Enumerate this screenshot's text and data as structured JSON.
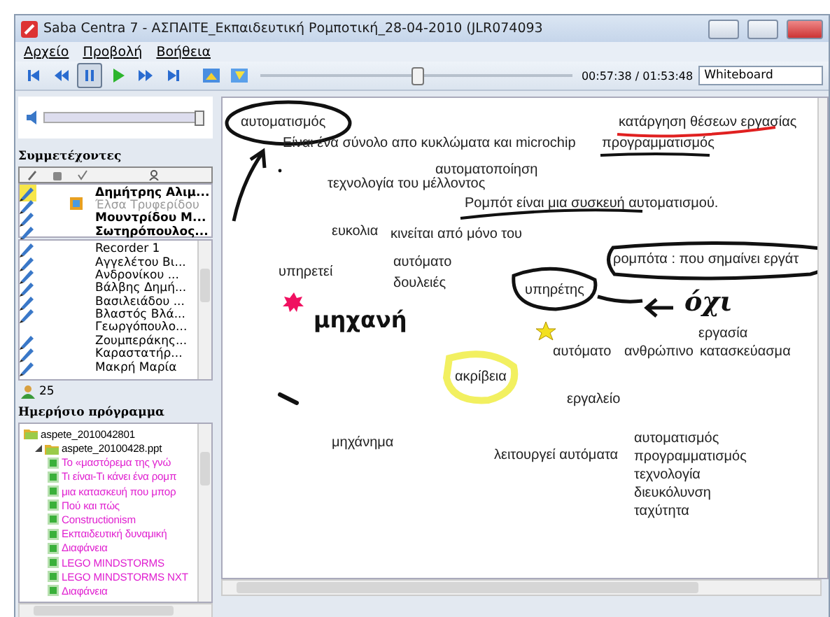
{
  "window": {
    "title": "Saba Centra 7 - ΑΣΠΑΙΤΕ_Εκπαιδευτική Ρομποτική_28-04-2010 (JLR074093"
  },
  "menu": [
    "Αρχείο",
    "Προβολή",
    "Βοήθεια"
  ],
  "toolbar": {
    "buttons": [
      {
        "kind": "first",
        "selected": false
      },
      {
        "kind": "rewind",
        "selected": false
      },
      {
        "kind": "pause",
        "selected": true
      },
      {
        "kind": "play",
        "selected": false
      },
      {
        "kind": "forward",
        "selected": false
      },
      {
        "kind": "last",
        "selected": false
      },
      {
        "kind": "image1",
        "selected": false
      },
      {
        "kind": "image2",
        "selected": false
      }
    ],
    "position": {
      "level": 0.5
    },
    "time": "00:57:38 / 01:53:48",
    "view": "Whiteboard"
  },
  "sidebar": {
    "volume": {
      "level": 1
    },
    "participants_title": "Συμμετέχοντες",
    "presenters": [
      {
        "name": "Δημήτρης Αλιμ...",
        "speaking": true,
        "present": true,
        "sharing": false
      },
      {
        "name": "Έλσα Τρυφερίδου",
        "speaking": false,
        "present": false,
        "sharing": true
      },
      {
        "name": "Μουντρίδου Μ...",
        "speaking": false,
        "present": true,
        "sharing": false
      },
      {
        "name": "Σωτηρόπουλος...",
        "speaking": false,
        "present": true,
        "sharing": false
      }
    ],
    "attendees": [
      {
        "name": "Recorder 1",
        "pen": true
      },
      {
        "name": "Αγγελέτου Βι...",
        "pen": true
      },
      {
        "name": "Ανδρονίκου ...",
        "pen": true
      },
      {
        "name": "Βάλβης Δημή...",
        "pen": true
      },
      {
        "name": "Βασιλειάδου ...",
        "pen": true
      },
      {
        "name": "Βλαστός Βλά...",
        "pen": true
      },
      {
        "name": "Γεωργόπουλο...",
        "pen": false
      },
      {
        "name": "Ζουμπεράκης...",
        "pen": true
      },
      {
        "name": "Καραστατήρ...",
        "pen": true
      },
      {
        "name": "Μακρή Μαρία",
        "pen": true
      }
    ],
    "count": "25",
    "agenda_title": "Ημερήσιο πρόγραμμα",
    "agenda": [
      {
        "label": "aspete_2010042801",
        "children": [
          {
            "label": "aspete_20100428.ppt",
            "expanded": true,
            "children": [
              {
                "label": "Το «μαστόρεμα της γνώ"
              },
              {
                "label": "Τι είναι-Τι κάνει ένα ρομπ"
              },
              {
                "label": "μια κατασκευή που μπορ"
              },
              {
                "label": "Πού και πώς"
              },
              {
                "label": "Constructionism"
              },
              {
                "label": "Εκπαιδευτική δυναμική"
              },
              {
                "label": "Διαφάνεια"
              },
              {
                "label": "LEGO MINDSTORMS"
              },
              {
                "label": "LEGO MINDSTORMS NXT"
              },
              {
                "label": "Διαφάνεια"
              }
            ]
          }
        ]
      }
    ]
  },
  "whiteboard": {
    "items": [
      {
        "kind": "text",
        "text": "αυτοματισμός"
      },
      {
        "kind": "text",
        "text": "Είναι ένα σύνολο απο κυκλώματα και microchip"
      },
      {
        "kind": "text",
        "text": "κατάργηση θέσεων εργασίας"
      },
      {
        "kind": "text",
        "text": "προγραμματισμός"
      },
      {
        "kind": "text",
        "text": "αυτοματοποίηση"
      },
      {
        "kind": "text",
        "text": "τεχνολογία του μέλλοντος"
      },
      {
        "kind": "text",
        "text": "Ρομπότ είναι μια συσκευή αυτοματισμού."
      },
      {
        "kind": "text",
        "text": "ευκολια"
      },
      {
        "kind": "text",
        "text": "κινείται από μόνο του"
      },
      {
        "kind": "text",
        "text": "ρομπότα : που σημαίνει εργάτ"
      },
      {
        "kind": "text",
        "text": "υπηρετεί"
      },
      {
        "kind": "text",
        "text": "αυτόματο"
      },
      {
        "kind": "text",
        "text": "δουλειές"
      },
      {
        "kind": "text",
        "text": "υπηρέτης"
      },
      {
        "kind": "handwriting",
        "text": "όχι"
      },
      {
        "kind": "heading",
        "text": "μηχανή"
      },
      {
        "kind": "text",
        "text": "αυτόματο"
      },
      {
        "kind": "text",
        "text": "ανθρώπινο"
      },
      {
        "kind": "text",
        "text": "εργασία"
      },
      {
        "kind": "text",
        "text": "κατασκεύασμα"
      },
      {
        "kind": "text",
        "text": "ακρίβεια"
      },
      {
        "kind": "text",
        "text": "εργαλείο"
      },
      {
        "kind": "text",
        "text": "μηχάνημα"
      },
      {
        "kind": "text",
        "text": "λειτουργεί αυτόματα"
      },
      {
        "kind": "text",
        "text": "αυτοματισμός"
      },
      {
        "kind": "text",
        "text": "προγραμματισμός"
      },
      {
        "kind": "text",
        "text": "τεχνολογία"
      },
      {
        "kind": "text",
        "text": "διευκόλυνση"
      },
      {
        "kind": "text",
        "text": "ταχύτητα"
      }
    ]
  }
}
